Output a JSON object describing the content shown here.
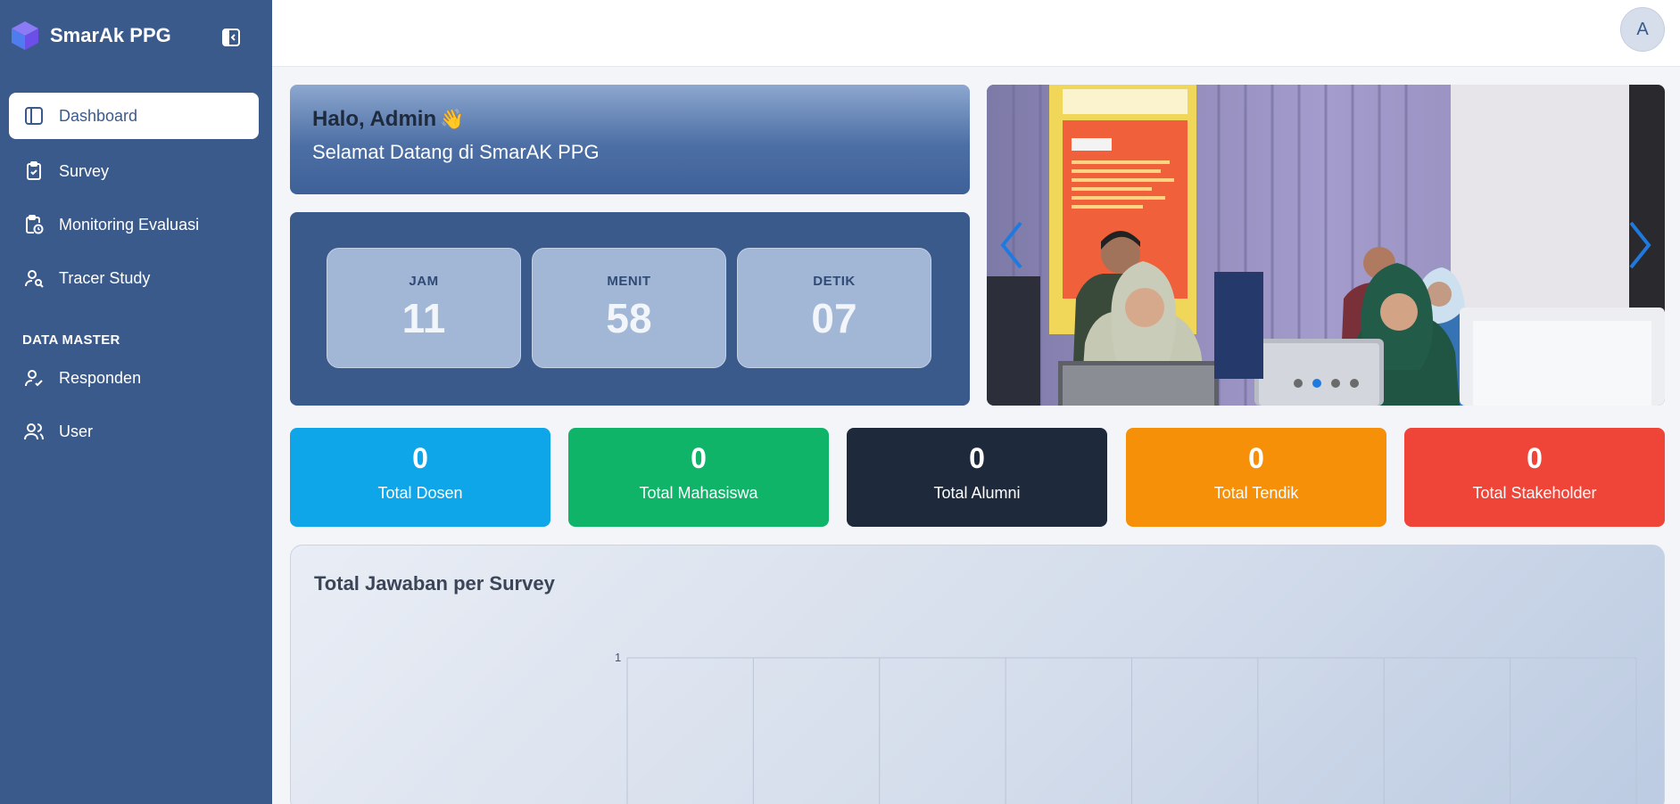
{
  "app": {
    "name": "SmarAk PPG"
  },
  "sidebar": {
    "items": [
      {
        "label": "Dashboard",
        "icon": "layout-icon",
        "active": true
      },
      {
        "label": "Survey",
        "icon": "clipboard-check-icon"
      },
      {
        "label": "Monitoring Evaluasi",
        "icon": "clipboard-clock-icon"
      },
      {
        "label": "Tracer Study",
        "icon": "user-search-icon"
      }
    ],
    "section_label": "DATA MASTER",
    "master_items": [
      {
        "label": "Responden",
        "icon": "user-check-icon"
      },
      {
        "label": "User",
        "icon": "users-icon"
      }
    ]
  },
  "topbar": {
    "avatar_initial": "A"
  },
  "welcome": {
    "greeting": "Halo, Admin",
    "emoji": "👋",
    "subtitle": "Selamat Datang di SmarAK PPG"
  },
  "clock": {
    "hours_label": "JAM",
    "hours": "11",
    "minutes_label": "MENIT",
    "minutes": "58",
    "seconds_label": "DETIK",
    "seconds": "07"
  },
  "carousel": {
    "slide_count": 4,
    "active_index": 1
  },
  "stats": [
    {
      "value": "0",
      "label": "Total Dosen",
      "color": "#0ea5e9"
    },
    {
      "value": "0",
      "label": "Total Mahasiswa",
      "color": "#10b468"
    },
    {
      "value": "0",
      "label": "Total Alumni",
      "color": "#1e293b"
    },
    {
      "value": "0",
      "label": "Total Tendik",
      "color": "#f59008"
    },
    {
      "value": "0",
      "label": "Total Stakeholder",
      "color": "#ef4438"
    }
  ],
  "chart": {
    "title": "Total Jawaban per Survey"
  },
  "chart_data": {
    "type": "bar",
    "title": "Total Jawaban per Survey",
    "categories": [],
    "values": [],
    "ylim": [
      0,
      1
    ],
    "y_ticks": [
      "1"
    ],
    "grid": true
  }
}
